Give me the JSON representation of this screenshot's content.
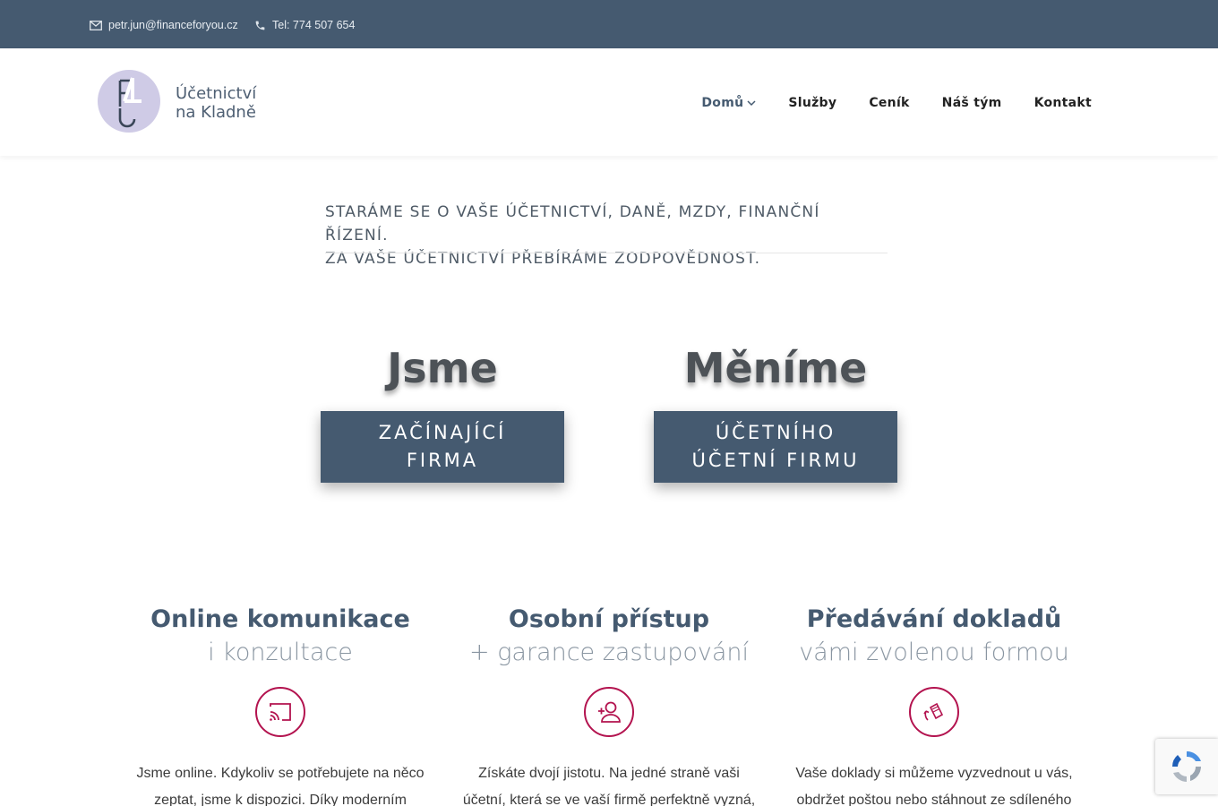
{
  "topbar": {
    "email": "petr.jun@financeforyou.cz",
    "phone": "Tel: 774 507 654"
  },
  "header": {
    "logo_text_line1": "Účetnictví",
    "logo_text_line2": "na Kladně",
    "nav": [
      {
        "label": "Domů",
        "active": true
      },
      {
        "label": "Služby"
      },
      {
        "label": "Ceník"
      },
      {
        "label": "Náš tým"
      },
      {
        "label": "Kontakt"
      }
    ]
  },
  "tagline": {
    "line1": "STARÁME SE O VAŠE ÚČETNICTVÍ, DANĚ, MZDY, FINANČNÍ ŘÍZENÍ.",
    "line2": "ZA VAŠE ÚČETNICTVÍ PŘEBÍRÁME ZODPOVĚDNOST."
  },
  "hero": [
    {
      "word": "Jsme",
      "box_line1": "ZAČÍNAJÍCÍ",
      "box_line2": "FIRMA"
    },
    {
      "word": "Měníme",
      "box_line1": "ÚČETNÍHO",
      "box_line2": "ÚČETNÍ FIRMU"
    }
  ],
  "features": [
    {
      "title": "Online komunikace",
      "subtitle": "i konzultace",
      "icon": "cast-icon",
      "text_line1": "Jsme online. Kdykoliv se potřebujete na něco",
      "text_line2": "zeptat, jsme k dispozici. Díky moderním"
    },
    {
      "title": "Osobní přístup",
      "subtitle": "+ garance zastupování",
      "icon": "add-user-icon",
      "text_line1": "Získáte dvojí jistotu. Na jedné straně vaši",
      "text_line2": "účetní, která se ve vaší firmě perfektně vyzná,"
    },
    {
      "title": "Předávání dokladů",
      "subtitle": "vámi zvolenou formou",
      "icon": "document-rotate-icon",
      "text_line1": "Vaše doklady si můžeme vyzvednout u vás,",
      "text_line2": "obdržet poštou nebo stáhnout ze sdíleného"
    }
  ],
  "colors": {
    "topbar": "#455a70",
    "accent": "#b3134f",
    "box": "#455a70"
  }
}
